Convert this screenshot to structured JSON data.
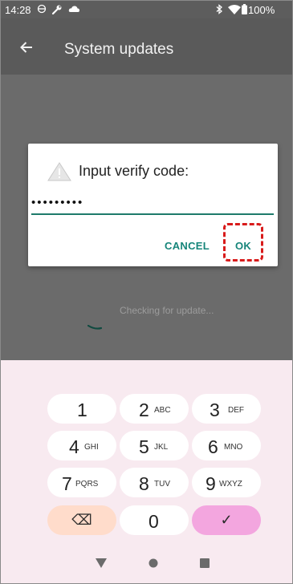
{
  "status_bar": {
    "time": "14:28",
    "icons": [
      "data-saver-icon",
      "wrench-icon",
      "cloud-icon",
      "bluetooth-icon",
      "wifi-icon",
      "battery-icon"
    ],
    "battery": "100%"
  },
  "app_bar": {
    "title": "System updates",
    "back_icon": "arrow-back-icon"
  },
  "dialog": {
    "icon": "warning-icon",
    "title": "Input verify code:",
    "input_value": "•••••••••",
    "cancel_label": "CANCEL",
    "ok_label": "OK",
    "highlight_color": "#d81b1b"
  },
  "background_content": {
    "status_text": "Checking for update..."
  },
  "keyboard": {
    "keys": [
      {
        "num": "1",
        "letters": ""
      },
      {
        "num": "2",
        "letters": "ABC"
      },
      {
        "num": "3",
        "letters": "DEF"
      },
      {
        "num": "4",
        "letters": "GHI"
      },
      {
        "num": "5",
        "letters": "JKL"
      },
      {
        "num": "6",
        "letters": "MNO"
      },
      {
        "num": "7",
        "letters": "PQRS"
      },
      {
        "num": "8",
        "letters": "TUV"
      },
      {
        "num": "9",
        "letters": "WXYZ"
      },
      {
        "num": "0",
        "letters": ""
      }
    ],
    "delete_icon": "backspace-icon",
    "done_glyph": "✓",
    "delete_glyph": "⌫"
  },
  "nav_bar": {
    "icons": [
      "back-triangle-icon",
      "home-circle-icon",
      "recents-square-icon"
    ]
  },
  "colors": {
    "accent": "#16857a",
    "keyboard_bg": "#f8eaf0",
    "done_key": "#f3a6df",
    "delete_key": "#ffdccb"
  }
}
